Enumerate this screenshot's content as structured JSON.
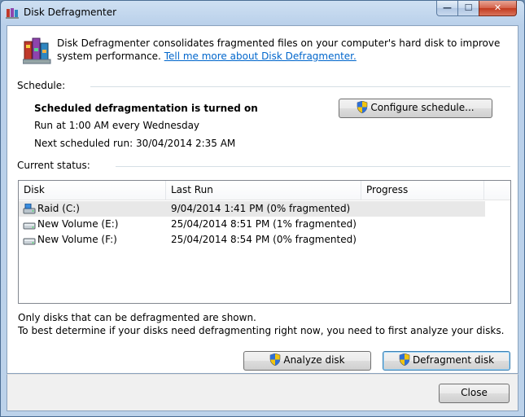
{
  "window": {
    "title": "Disk Defragmenter",
    "controls": {
      "minimize": "—",
      "maximize": "☐",
      "close": "✕"
    }
  },
  "intro": {
    "text": "Disk Defragmenter consolidates fragmented files on your computer's hard disk to improve system performance. ",
    "link": "Tell me more about Disk Defragmenter."
  },
  "schedule": {
    "label": "Schedule:",
    "status": "Scheduled defragmentation is turned on",
    "run_at": "Run at 1:00 AM every Wednesday",
    "next_run": "Next scheduled run: 30/04/2014 2:35 AM",
    "configure_button": "Configure schedule..."
  },
  "current_status": {
    "label": "Current status:",
    "columns": [
      "Disk",
      "Last Run",
      "Progress"
    ],
    "rows": [
      {
        "disk": "Raid (C:)",
        "last_run": "9/04/2014 1:41 PM (0% fragmented)",
        "progress": "",
        "icon": "system-drive-icon"
      },
      {
        "disk": "New Volume (E:)",
        "last_run": "25/04/2014 8:51 PM (1% fragmented)",
        "progress": "",
        "icon": "hard-drive-icon"
      },
      {
        "disk": "New Volume (F:)",
        "last_run": "25/04/2014 8:54 PM (0% fragmented)",
        "progress": "",
        "icon": "hard-drive-icon"
      }
    ]
  },
  "notes": {
    "line1": "Only disks that can be defragmented are shown.",
    "line2": "To best determine if your disks need defragmenting right now, you need to first analyze your disks."
  },
  "buttons": {
    "analyze": "Analyze disk",
    "defragment": "Defragment disk",
    "close": "Close"
  },
  "colors": {
    "link": "#0066cc",
    "selection": "#e8e8e8",
    "titlebar": "#b9d0ea"
  }
}
